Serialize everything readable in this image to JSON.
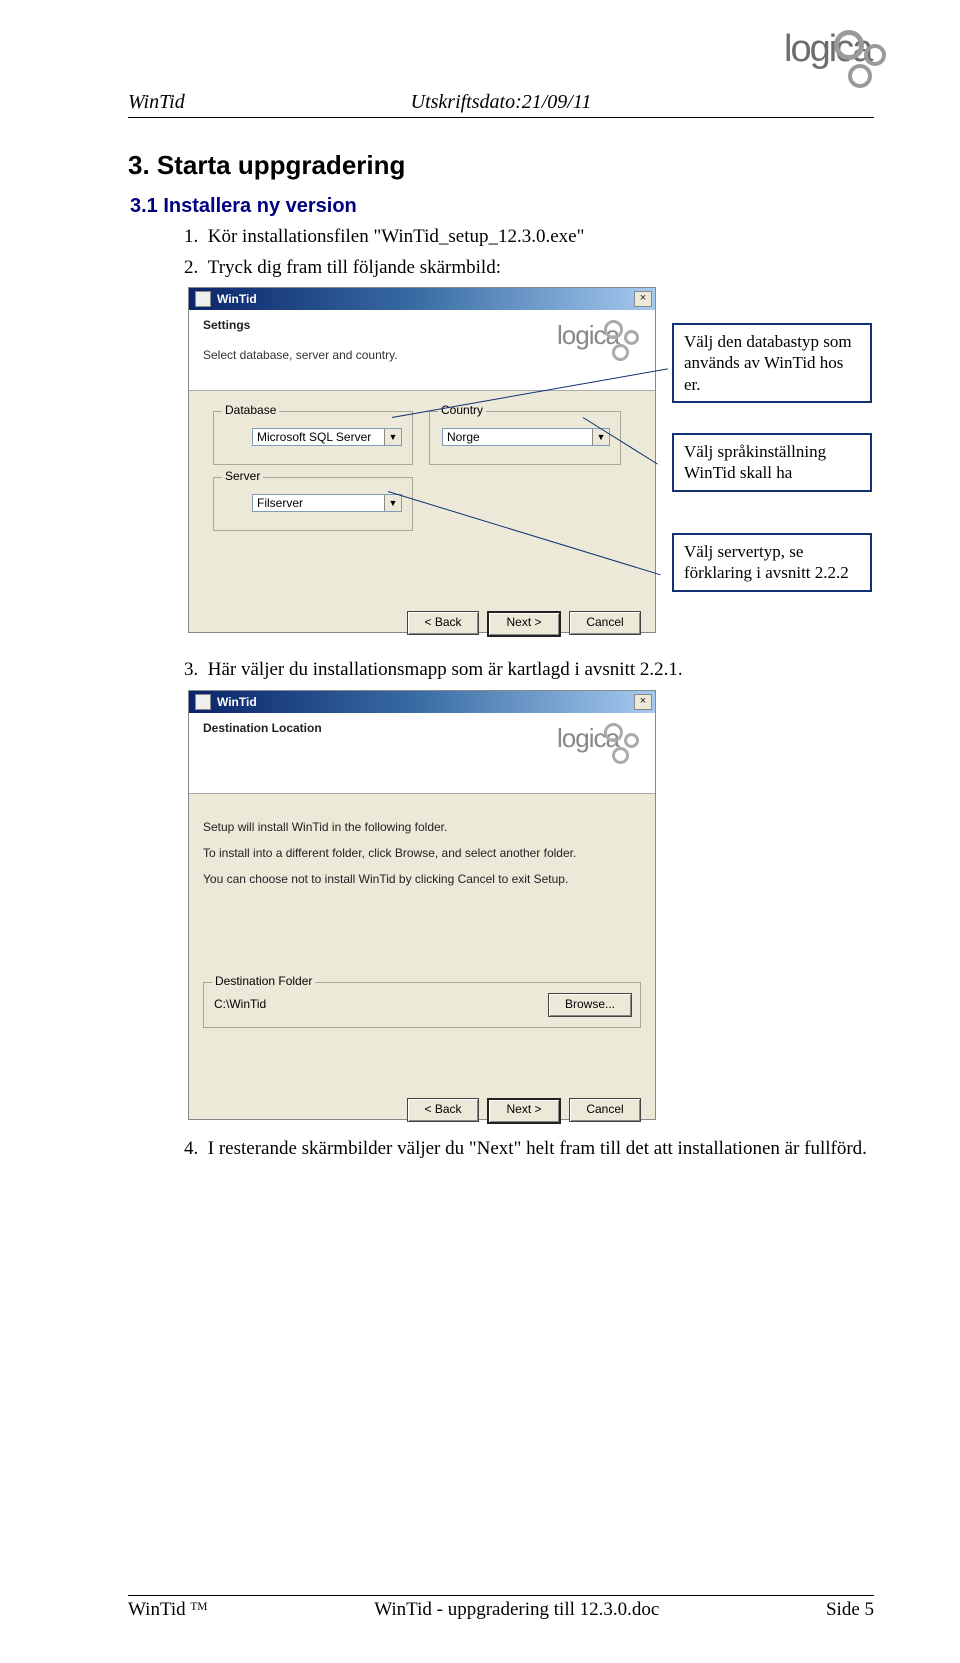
{
  "header": {
    "left": "WinTid",
    "center": "Utskriftsdato:21/09/11",
    "logo_text": "logica"
  },
  "section": {
    "heading": "3. Starta uppgradering",
    "subheading": "3.1 Installera ny version"
  },
  "steps": {
    "s1": "Kör installationsfilen \"WinTid_setup_12.3.0.exe\"",
    "s2": "Tryck dig fram till följande skärmbild:",
    "s3": "Här väljer du installationsmapp som är kartlagd i avsnitt 2.2.1.",
    "s4": "I resterande skärmbilder väljer du \"Next\" helt fram till det att installationen är fullförd."
  },
  "dialog1": {
    "title": "WinTid",
    "close": "×",
    "banner_title": "Settings",
    "subtext": "Select database, server and country.",
    "group_database": "Database",
    "db_value": "Microsoft SQL Server",
    "group_country": "Country",
    "country_value": "Norge",
    "group_server": "Server",
    "server_value": "Filserver",
    "btn_back": "< Back",
    "btn_next": "Next >",
    "btn_cancel": "Cancel"
  },
  "dialog2": {
    "title": "WinTid",
    "close": "×",
    "banner_title": "Destination Location",
    "line1": "Setup will install WinTid in the following folder.",
    "line2": "To install into a different folder, click Browse, and select another folder.",
    "line3": "You can choose not to install WinTid by clicking Cancel to exit Setup.",
    "group_dest": "Destination Folder",
    "dest_path": "C:\\WinTid",
    "btn_browse": "Browse...",
    "btn_back": "< Back",
    "btn_next": "Next >",
    "btn_cancel": "Cancel"
  },
  "callouts": {
    "db": "Välj den databastyp som används av WinTid hos er.",
    "lang": "Välj språkinställning WinTid skall ha",
    "server": "Välj servertyp, se förklaring i avsnitt 2.2.2"
  },
  "footer": {
    "left": "WinTid ᵀᴹ",
    "center": "WinTid - uppgradering till 12.3.0.doc",
    "right": "Side 5"
  }
}
